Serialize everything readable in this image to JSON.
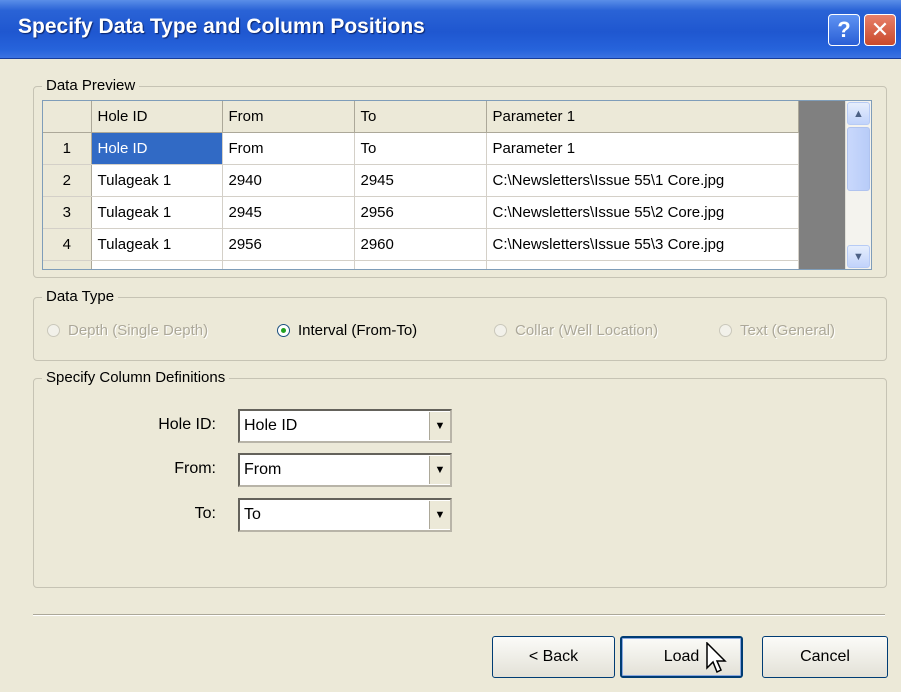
{
  "window": {
    "title": "Specify Data Type and Column Positions",
    "help_label": "?",
    "close_label": "✕"
  },
  "data_preview": {
    "label": "Data Preview",
    "headers": [
      "Hole ID",
      "From",
      "To",
      "Parameter 1"
    ],
    "rows": [
      {
        "num": "1",
        "cells": [
          "Hole ID",
          "From",
          "To",
          "Parameter 1"
        ]
      },
      {
        "num": "2",
        "cells": [
          "Tulageak 1",
          "2940",
          "2945",
          "C:\\Newsletters\\Issue 55\\1 Core.jpg"
        ]
      },
      {
        "num": "3",
        "cells": [
          "Tulageak 1",
          "2945",
          "2956",
          "C:\\Newsletters\\Issue 55\\2 Core.jpg"
        ]
      },
      {
        "num": "4",
        "cells": [
          "Tulageak 1",
          "2956",
          "2960",
          "C:\\Newsletters\\Issue 55\\3 Core.jpg"
        ]
      }
    ]
  },
  "data_type": {
    "label": "Data Type",
    "options": [
      {
        "label": "Depth (Single Depth)",
        "enabled": false,
        "checked": false
      },
      {
        "label": "Interval (From-To)",
        "enabled": true,
        "checked": true
      },
      {
        "label": "Collar (Well Location)",
        "enabled": false,
        "checked": false
      },
      {
        "label": "Text (General)",
        "enabled": false,
        "checked": false
      }
    ]
  },
  "column_definitions": {
    "label": "Specify Column Definitions",
    "hole_id_label": "Hole ID:",
    "hole_id_value": "Hole ID",
    "from_label": "From:",
    "from_value": "From",
    "to_label": "To:",
    "to_value": "To"
  },
  "buttons": {
    "back": "< Back",
    "load": "Load",
    "cancel": "Cancel"
  },
  "colors": {
    "titlebar": "#2a63d6",
    "selection": "#316ac5",
    "dialog_bg": "#ece9d8"
  }
}
